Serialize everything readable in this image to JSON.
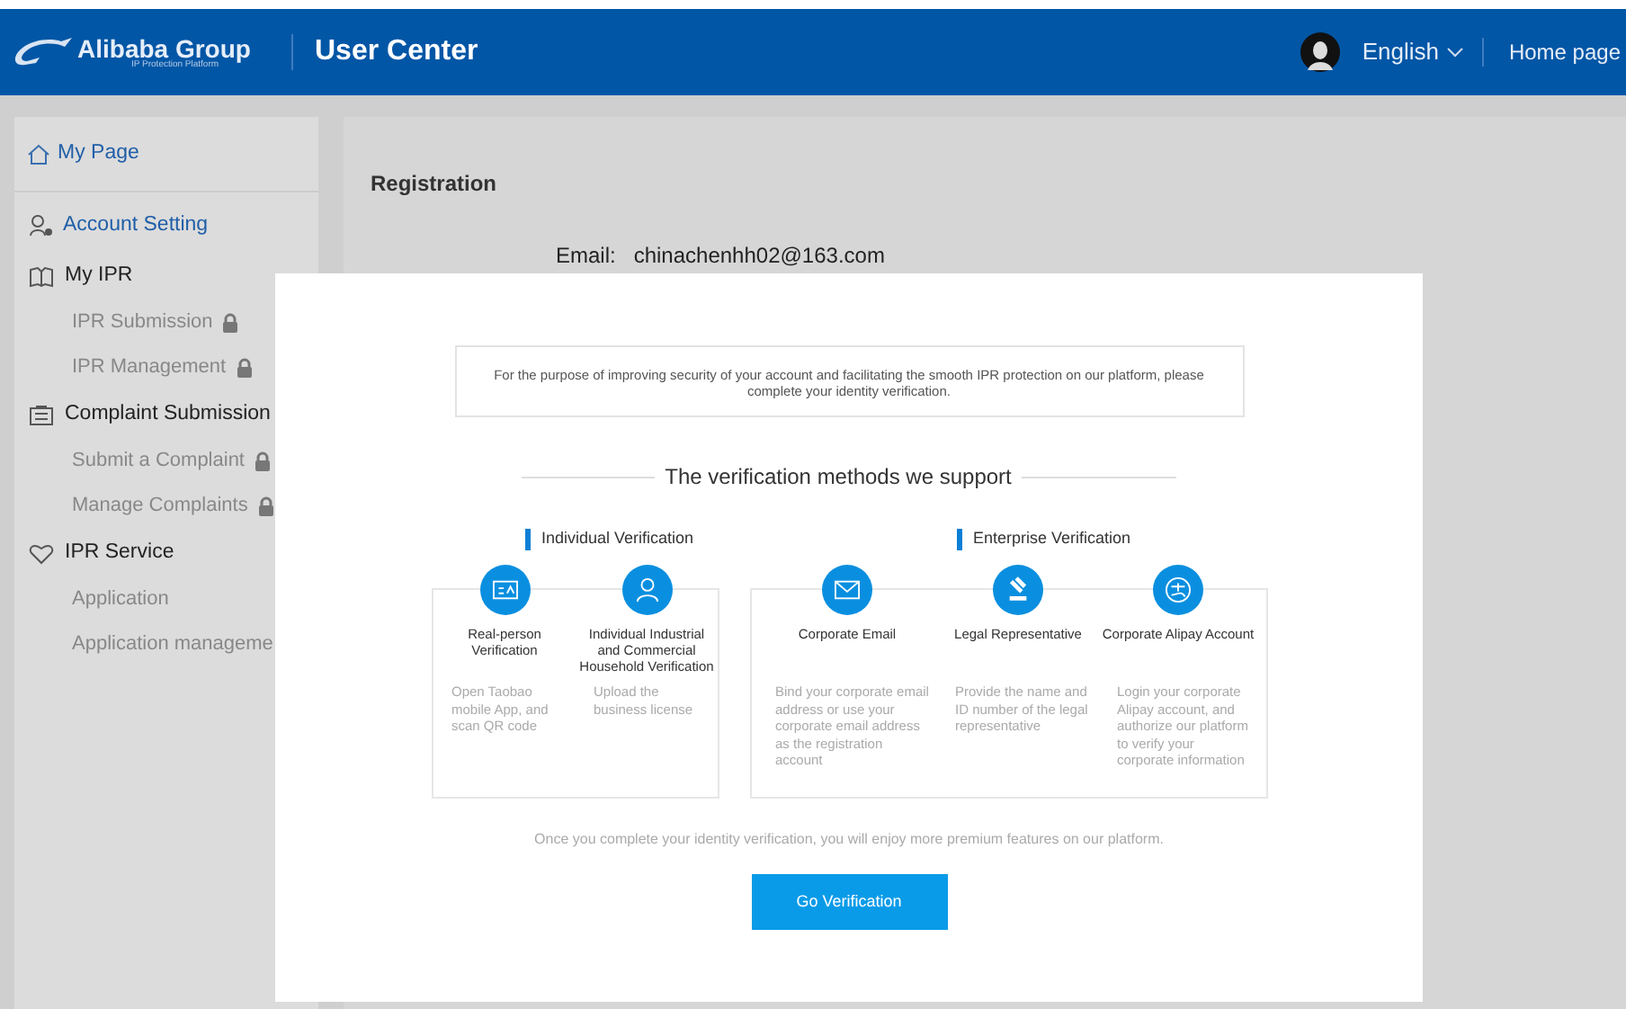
{
  "header": {
    "logo": "Alibaba Group",
    "logo_subtitle": "IP Protection Platform",
    "title": "User Center",
    "language": "English",
    "home_link": "Home page"
  },
  "sidebar": {
    "items": [
      {
        "label": "My Page",
        "kind": "link"
      },
      {
        "label": "Account Setting",
        "kind": "link"
      },
      {
        "label": "My IPR",
        "kind": "group",
        "children": [
          {
            "label": "IPR Submission",
            "locked": true
          },
          {
            "label": "IPR Management",
            "locked": true
          }
        ]
      },
      {
        "label": "Complaint Submission",
        "kind": "group",
        "children": [
          {
            "label": "Submit a Complaint",
            "locked": true
          },
          {
            "label": "Manage Complaints",
            "locked": true
          }
        ]
      },
      {
        "label": "IPR Service",
        "kind": "group",
        "children": [
          {
            "label": "Application",
            "locked": false
          },
          {
            "label": "Application manageme",
            "locked": false
          }
        ]
      }
    ]
  },
  "main": {
    "heading": "Registration",
    "email_label": "Email:",
    "email": "chinachenhh02@163.com"
  },
  "dialog": {
    "notice": "For the purpose of improving security of your account and facilitating the smooth IPR protection on our platform, please complete your identity verification.",
    "title": "The verification methods we support",
    "groups": [
      {
        "title": "Individual Verification",
        "methods": [
          {
            "title": "Real-person Verification",
            "description": "Open Taobao mobile App, and scan QR code"
          },
          {
            "title": "Individual Industrial and Commercial Household Verification",
            "description": "Upload the business license"
          }
        ]
      },
      {
        "title": "Enterprise Verification",
        "methods": [
          {
            "title": "Corporate Email",
            "description": "Bind your corporate email address or use your corporate email address as the registration account"
          },
          {
            "title": "Legal Representative",
            "description": "Provide the name and ID number of the legal representative"
          },
          {
            "title": "Corporate Alipay Account",
            "description": "Login your corporate Alipay account, and authorize our platform to verify your corporate information"
          }
        ]
      }
    ],
    "footnote": "Once you complete your identity verification,  you will enjoy more premium features on our platform.",
    "button": "Go Verification"
  }
}
